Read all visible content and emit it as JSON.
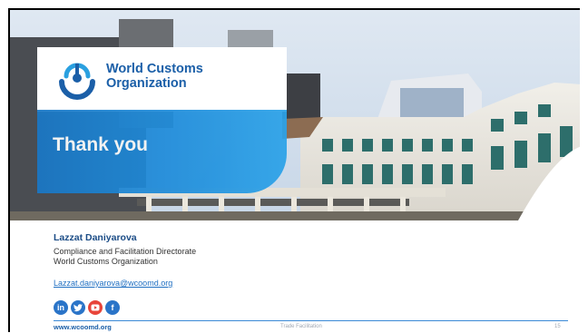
{
  "logo": {
    "line1": "World Customs",
    "line2": "Organization"
  },
  "title": "Thank you",
  "speaker": {
    "name": "Lazzat Daniyarova",
    "line1": "Compliance and Facilitation Directorate",
    "line2": "World Customs Organization",
    "email": "Lazzat.daniyarova@wcoomd.org"
  },
  "social": [
    {
      "icon": "linkedin-icon",
      "glyph": "in"
    },
    {
      "icon": "twitter-icon",
      "glyph": ""
    },
    {
      "icon": "youtube-icon",
      "glyph": ""
    },
    {
      "icon": "facebook-icon",
      "glyph": "f"
    }
  ],
  "footer": {
    "url": "www.wcoomd.org",
    "section": "Trade Facilitation",
    "page": "15"
  },
  "colors": {
    "brand_blue": "#1b5fa8",
    "band_blue": "#1f8ddb",
    "link_blue": "#1f6fc2"
  }
}
